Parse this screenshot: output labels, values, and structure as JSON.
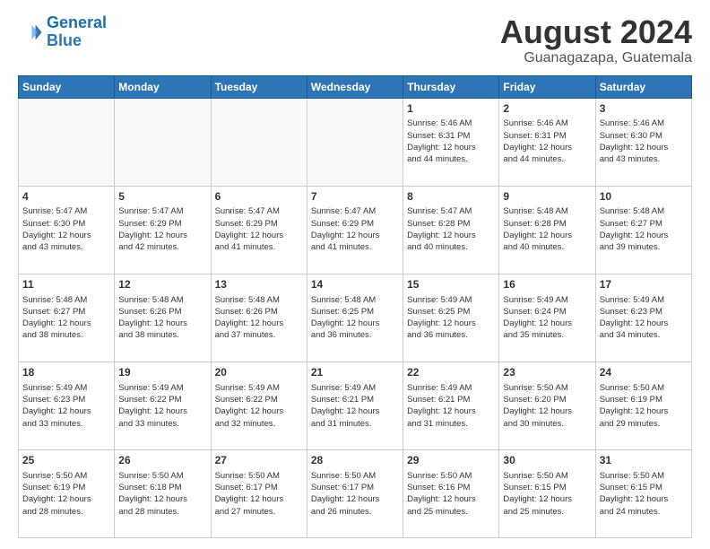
{
  "logo": {
    "line1": "General",
    "line2": "Blue"
  },
  "title": "August 2024",
  "subtitle": "Guanagazapa, Guatemala",
  "days": [
    "Sunday",
    "Monday",
    "Tuesday",
    "Wednesday",
    "Thursday",
    "Friday",
    "Saturday"
  ],
  "weeks": [
    [
      {
        "num": "",
        "info": ""
      },
      {
        "num": "",
        "info": ""
      },
      {
        "num": "",
        "info": ""
      },
      {
        "num": "",
        "info": ""
      },
      {
        "num": "1",
        "info": "Sunrise: 5:46 AM\nSunset: 6:31 PM\nDaylight: 12 hours\nand 44 minutes."
      },
      {
        "num": "2",
        "info": "Sunrise: 5:46 AM\nSunset: 6:31 PM\nDaylight: 12 hours\nand 44 minutes."
      },
      {
        "num": "3",
        "info": "Sunrise: 5:46 AM\nSunset: 6:30 PM\nDaylight: 12 hours\nand 43 minutes."
      }
    ],
    [
      {
        "num": "4",
        "info": "Sunrise: 5:47 AM\nSunset: 6:30 PM\nDaylight: 12 hours\nand 43 minutes."
      },
      {
        "num": "5",
        "info": "Sunrise: 5:47 AM\nSunset: 6:29 PM\nDaylight: 12 hours\nand 42 minutes."
      },
      {
        "num": "6",
        "info": "Sunrise: 5:47 AM\nSunset: 6:29 PM\nDaylight: 12 hours\nand 41 minutes."
      },
      {
        "num": "7",
        "info": "Sunrise: 5:47 AM\nSunset: 6:29 PM\nDaylight: 12 hours\nand 41 minutes."
      },
      {
        "num": "8",
        "info": "Sunrise: 5:47 AM\nSunset: 6:28 PM\nDaylight: 12 hours\nand 40 minutes."
      },
      {
        "num": "9",
        "info": "Sunrise: 5:48 AM\nSunset: 6:28 PM\nDaylight: 12 hours\nand 40 minutes."
      },
      {
        "num": "10",
        "info": "Sunrise: 5:48 AM\nSunset: 6:27 PM\nDaylight: 12 hours\nand 39 minutes."
      }
    ],
    [
      {
        "num": "11",
        "info": "Sunrise: 5:48 AM\nSunset: 6:27 PM\nDaylight: 12 hours\nand 38 minutes."
      },
      {
        "num": "12",
        "info": "Sunrise: 5:48 AM\nSunset: 6:26 PM\nDaylight: 12 hours\nand 38 minutes."
      },
      {
        "num": "13",
        "info": "Sunrise: 5:48 AM\nSunset: 6:26 PM\nDaylight: 12 hours\nand 37 minutes."
      },
      {
        "num": "14",
        "info": "Sunrise: 5:48 AM\nSunset: 6:25 PM\nDaylight: 12 hours\nand 36 minutes."
      },
      {
        "num": "15",
        "info": "Sunrise: 5:49 AM\nSunset: 6:25 PM\nDaylight: 12 hours\nand 36 minutes."
      },
      {
        "num": "16",
        "info": "Sunrise: 5:49 AM\nSunset: 6:24 PM\nDaylight: 12 hours\nand 35 minutes."
      },
      {
        "num": "17",
        "info": "Sunrise: 5:49 AM\nSunset: 6:23 PM\nDaylight: 12 hours\nand 34 minutes."
      }
    ],
    [
      {
        "num": "18",
        "info": "Sunrise: 5:49 AM\nSunset: 6:23 PM\nDaylight: 12 hours\nand 33 minutes."
      },
      {
        "num": "19",
        "info": "Sunrise: 5:49 AM\nSunset: 6:22 PM\nDaylight: 12 hours\nand 33 minutes."
      },
      {
        "num": "20",
        "info": "Sunrise: 5:49 AM\nSunset: 6:22 PM\nDaylight: 12 hours\nand 32 minutes."
      },
      {
        "num": "21",
        "info": "Sunrise: 5:49 AM\nSunset: 6:21 PM\nDaylight: 12 hours\nand 31 minutes."
      },
      {
        "num": "22",
        "info": "Sunrise: 5:49 AM\nSunset: 6:21 PM\nDaylight: 12 hours\nand 31 minutes."
      },
      {
        "num": "23",
        "info": "Sunrise: 5:50 AM\nSunset: 6:20 PM\nDaylight: 12 hours\nand 30 minutes."
      },
      {
        "num": "24",
        "info": "Sunrise: 5:50 AM\nSunset: 6:19 PM\nDaylight: 12 hours\nand 29 minutes."
      }
    ],
    [
      {
        "num": "25",
        "info": "Sunrise: 5:50 AM\nSunset: 6:19 PM\nDaylight: 12 hours\nand 28 minutes."
      },
      {
        "num": "26",
        "info": "Sunrise: 5:50 AM\nSunset: 6:18 PM\nDaylight: 12 hours\nand 28 minutes."
      },
      {
        "num": "27",
        "info": "Sunrise: 5:50 AM\nSunset: 6:17 PM\nDaylight: 12 hours\nand 27 minutes."
      },
      {
        "num": "28",
        "info": "Sunrise: 5:50 AM\nSunset: 6:17 PM\nDaylight: 12 hours\nand 26 minutes."
      },
      {
        "num": "29",
        "info": "Sunrise: 5:50 AM\nSunset: 6:16 PM\nDaylight: 12 hours\nand 25 minutes."
      },
      {
        "num": "30",
        "info": "Sunrise: 5:50 AM\nSunset: 6:15 PM\nDaylight: 12 hours\nand 25 minutes."
      },
      {
        "num": "31",
        "info": "Sunrise: 5:50 AM\nSunset: 6:15 PM\nDaylight: 12 hours\nand 24 minutes."
      }
    ]
  ]
}
